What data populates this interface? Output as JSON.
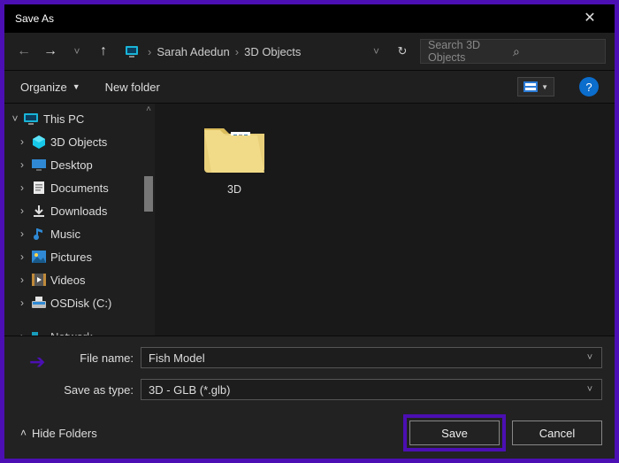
{
  "title": "Save As",
  "breadcrumb": {
    "user": "Sarah Adedun",
    "folder": "3D Objects"
  },
  "search": {
    "placeholder": "Search 3D Objects"
  },
  "toolbar": {
    "organize": "Organize",
    "new_folder": "New folder"
  },
  "tree": {
    "root": "This PC",
    "items": [
      {
        "label": "3D Objects"
      },
      {
        "label": "Desktop"
      },
      {
        "label": "Documents"
      },
      {
        "label": "Downloads"
      },
      {
        "label": "Music"
      },
      {
        "label": "Pictures"
      },
      {
        "label": "Videos"
      },
      {
        "label": "OSDisk (C:)"
      }
    ],
    "network": "Network"
  },
  "content": {
    "folder_name": "3D"
  },
  "file_name": {
    "label": "File name:",
    "value": "Fish Model"
  },
  "file_type": {
    "label": "Save as type:",
    "value": "3D - GLB (*.glb)"
  },
  "buttons": {
    "save": "Save",
    "cancel": "Cancel",
    "hide_folders": "Hide Folders"
  }
}
